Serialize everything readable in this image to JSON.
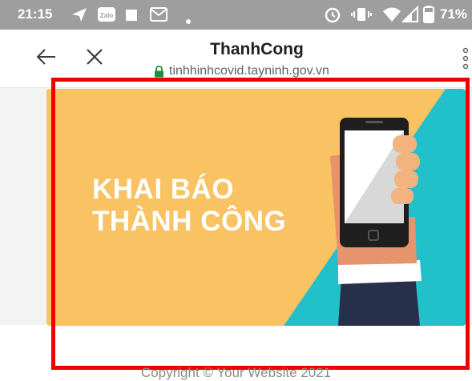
{
  "status_bar": {
    "time": "21:15",
    "battery": "71%",
    "icons": [
      "send-icon",
      "zalo-icon",
      "message-icon",
      "gmail-icon",
      "dot-icon",
      "alarm-icon",
      "vibrate-icon",
      "wifi-icon",
      "signal-icon",
      "battery-icon"
    ]
  },
  "browser": {
    "title": "ThanhCong",
    "url": "tinhhinhcovid.tayninh.gov.vn",
    "icons": [
      "back-arrow-icon",
      "close-icon",
      "more-vert-icon",
      "lock-icon"
    ]
  },
  "banner": {
    "line1": "KHAI BÁO",
    "line2": "THÀNH CÔNG",
    "colors": {
      "yellow": "#f9c262",
      "teal": "#22c1c9"
    },
    "icons": [
      "hand-holding-phone-icon"
    ]
  },
  "footer": {
    "copyright": "Copyright © Your Website 2021"
  },
  "colors": {
    "highlight": "#ee0000",
    "status_bar": "#9e9e9e"
  }
}
